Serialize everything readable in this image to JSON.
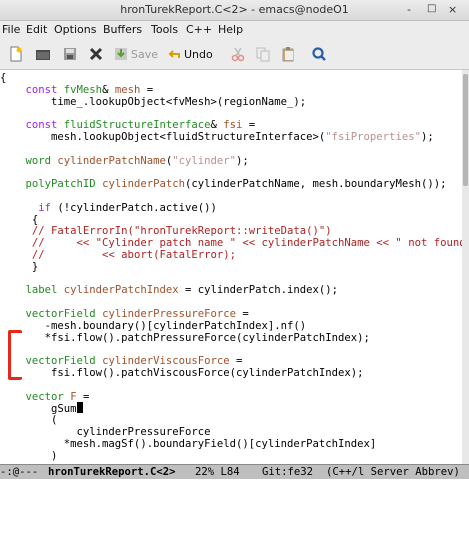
{
  "window": {
    "title": "hronTurekReport.C<2> - emacs@nodeO1",
    "minimize": "-",
    "maximize": "□",
    "close": "×"
  },
  "menu": [
    "File",
    "Edit",
    "Options",
    "Buffers",
    "Tools",
    "C++",
    "Help"
  ],
  "toolbar": {
    "save_label": "Save",
    "undo_label": "Undo",
    "icons": [
      "new-file-icon",
      "open-folder-icon",
      "save-disk-icon",
      "close-x-icon",
      "save-icon",
      "undo-icon",
      "cut-icon",
      "copy-icon",
      "paste-icon",
      "search-icon"
    ]
  },
  "code": [
    [
      [
        "{",
        ""
      ]
    ],
    [
      [
        "    ",
        ""
      ],
      [
        "const",
        "kw"
      ],
      [
        " ",
        ""
      ],
      [
        "fvMesh",
        "ty"
      ],
      [
        "& ",
        ""
      ],
      [
        "mesh",
        "vr"
      ],
      [
        " =",
        ""
      ]
    ],
    [
      [
        "        time_.lookupObject<fvMesh>(regionName_);",
        ""
      ]
    ],
    [
      [
        "",
        ""
      ]
    ],
    [
      [
        "    ",
        ""
      ],
      [
        "const",
        "kw"
      ],
      [
        " ",
        ""
      ],
      [
        "fluidStructureInterface",
        "ty"
      ],
      [
        "& ",
        ""
      ],
      [
        "fsi",
        "vr"
      ],
      [
        " =",
        ""
      ]
    ],
    [
      [
        "        mesh.lookupObject<fluidStructureInterface>(",
        ""
      ],
      [
        "\"fsiProperties\"",
        "st"
      ],
      [
        ");",
        ""
      ]
    ],
    [
      [
        "",
        ""
      ]
    ],
    [
      [
        "    ",
        ""
      ],
      [
        "word",
        "ty"
      ],
      [
        " ",
        ""
      ],
      [
        "cylinderPatchName",
        "vr"
      ],
      [
        "(",
        ""
      ],
      [
        "\"cylinder\"",
        "st"
      ],
      [
        ");",
        ""
      ]
    ],
    [
      [
        "",
        ""
      ]
    ],
    [
      [
        "    ",
        ""
      ],
      [
        "polyPatchID",
        "ty"
      ],
      [
        " ",
        ""
      ],
      [
        "cylinderPatch",
        "vr"
      ],
      [
        "(cylinderPatchName, mesh.boundaryMesh());",
        ""
      ]
    ],
    [
      [
        "",
        ""
      ]
    ],
    [
      [
        "      ",
        ""
      ],
      [
        "if",
        "kw"
      ],
      [
        " (!cylinderPatch.active())",
        ""
      ]
    ],
    [
      [
        "     {",
        ""
      ]
    ],
    [
      [
        "     ",
        ""
      ],
      [
        "// FatalErrorIn(\"hronTurekReport::writeData()\")",
        "cm"
      ]
    ],
    [
      [
        "     ",
        ""
      ],
      [
        "//     << \"Cylinder patch name \" << cylinderPatchName << \" not found.\"",
        "cm"
      ]
    ],
    [
      [
        "     ",
        ""
      ],
      [
        "//         << abort(FatalError);",
        "cm"
      ]
    ],
    [
      [
        "     }",
        ""
      ]
    ],
    [
      [
        "",
        ""
      ]
    ],
    [
      [
        "    ",
        ""
      ],
      [
        "label",
        "ty"
      ],
      [
        " ",
        ""
      ],
      [
        "cylinderPatchIndex",
        "vr"
      ],
      [
        " = cylinderPatch.index();",
        ""
      ]
    ],
    [
      [
        "",
        ""
      ]
    ],
    [
      [
        "    ",
        ""
      ],
      [
        "vectorField",
        "ty"
      ],
      [
        " ",
        ""
      ],
      [
        "cylinderPressureForce",
        "vr"
      ],
      [
        " =",
        ""
      ]
    ],
    [
      [
        "       -mesh.boundary()[cylinderPatchIndex].nf()",
        ""
      ]
    ],
    [
      [
        "       *fsi.flow().patchPressureForce(cylinderPatchIndex);",
        ""
      ]
    ],
    [
      [
        "",
        ""
      ]
    ],
    [
      [
        "    ",
        ""
      ],
      [
        "vectorField",
        "ty"
      ],
      [
        " ",
        ""
      ],
      [
        "cylinderViscousForce",
        "vr"
      ],
      [
        " =",
        ""
      ]
    ],
    [
      [
        "        fsi.flow().patchViscousForce(cylinderPatchIndex);",
        ""
      ]
    ],
    [
      [
        "",
        ""
      ]
    ],
    [
      [
        "    ",
        ""
      ],
      [
        "vector",
        "ty"
      ],
      [
        " ",
        ""
      ],
      [
        "F",
        "vr"
      ],
      [
        " =",
        ""
      ]
    ],
    [
      [
        "        gSum",
        ""
      ]
    ],
    [
      [
        "        (",
        ""
      ]
    ],
    [
      [
        "            cylinderPressureForce",
        ""
      ]
    ],
    [
      [
        "          *mesh.magSf().boundaryField()[cylinderPatchIndex]",
        ""
      ]
    ],
    [
      [
        "        )",
        ""
      ]
    ]
  ],
  "modeline": {
    "flags": "-:@---",
    "buffer": "hronTurekReport.C<2>",
    "position": "22% L84",
    "vcs": "Git:fe32",
    "modes": "(C++/l Server Abbrev)"
  },
  "colors": {
    "keyword": "#a020f0",
    "type": "#228b22",
    "variable": "#a0522d",
    "string": "#bc8f8f",
    "comment": "#b22222",
    "annotation": "#e8271c"
  }
}
